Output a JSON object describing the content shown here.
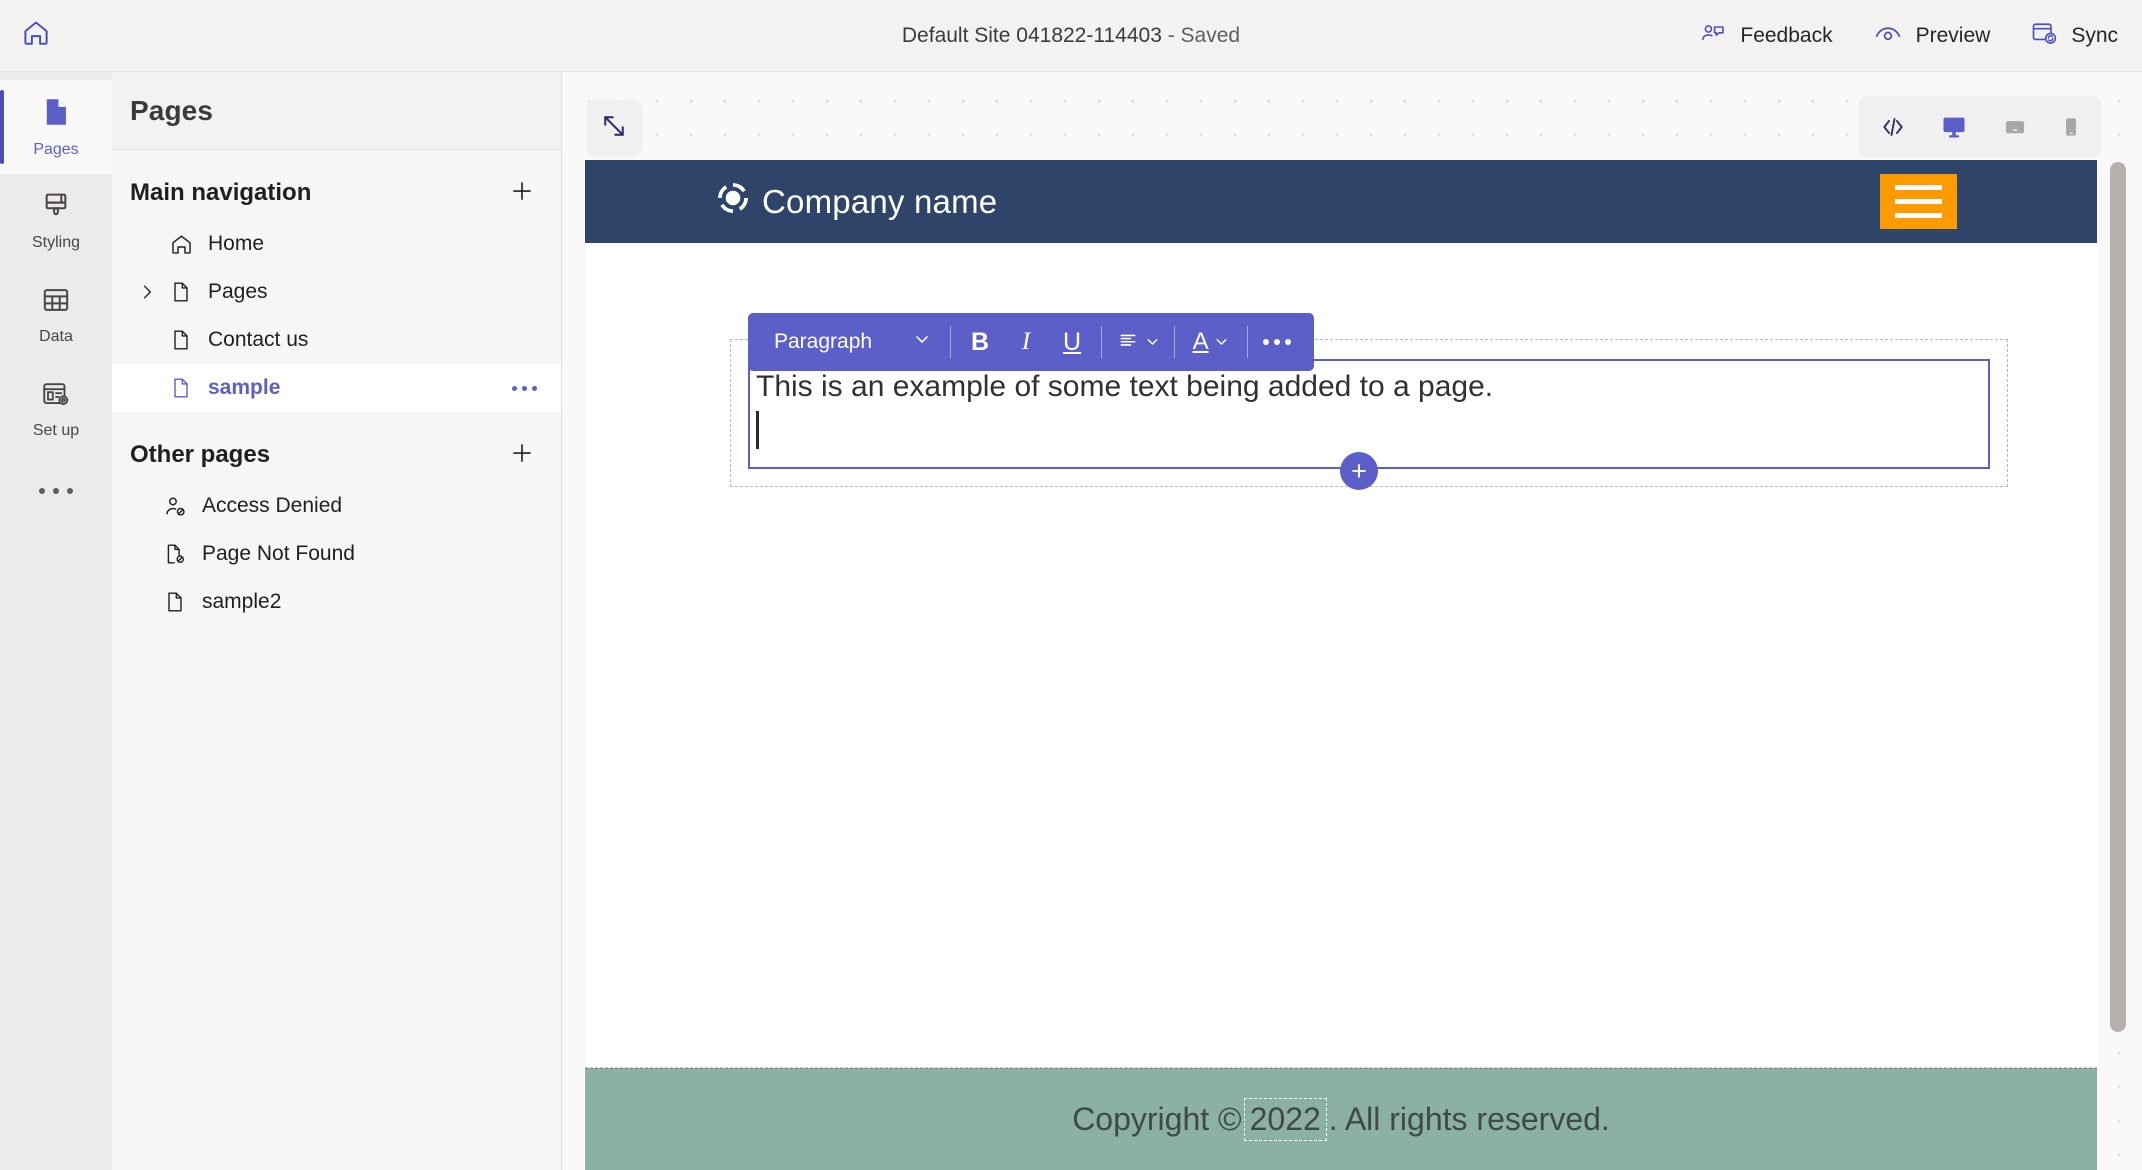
{
  "topbar": {
    "home_icon": "home-icon",
    "title_main": "Default Site 041822-114403",
    "title_sep": " - ",
    "title_state": "Saved",
    "actions": [
      {
        "label": "Feedback",
        "icon": "feedback-person-chat-icon"
      },
      {
        "label": "Preview",
        "icon": "eye-preview-icon"
      },
      {
        "label": "Sync",
        "icon": "sync-browser-icon"
      }
    ]
  },
  "rail": {
    "items": [
      {
        "label": "Pages",
        "icon": "page-document-icon",
        "active": true
      },
      {
        "label": "Styling",
        "icon": "paint-brush-icon",
        "active": false
      },
      {
        "label": "Data",
        "icon": "table-grid-icon",
        "active": false
      },
      {
        "label": "Set up",
        "icon": "setup-gear-window-icon",
        "active": false
      }
    ],
    "overflow_icon": "ellipsis-icon"
  },
  "panel": {
    "title": "Pages",
    "groups": [
      {
        "title": "Main navigation",
        "add_icon": "plus-icon",
        "items": [
          {
            "label": "Home",
            "icon": "home-outline-icon",
            "expandable": false,
            "selected": false
          },
          {
            "label": "Pages",
            "icon": "page-outline-icon",
            "expandable": true,
            "selected": false
          },
          {
            "label": "Contact us",
            "icon": "page-outline-icon",
            "expandable": false,
            "selected": false
          },
          {
            "label": "sample",
            "icon": "page-outline-icon",
            "expandable": false,
            "selected": true,
            "more_icon": "more-ellipsis-icon"
          }
        ]
      },
      {
        "title": "Other pages",
        "add_icon": "plus-icon",
        "items": [
          {
            "label": "Access Denied",
            "icon": "person-denied-icon",
            "expandable": false,
            "selected": false
          },
          {
            "label": "Page Not Found",
            "icon": "page-denied-icon",
            "expandable": false,
            "selected": false
          },
          {
            "label": "sample2",
            "icon": "page-outline-icon",
            "expandable": false,
            "selected": false
          }
        ]
      }
    ]
  },
  "canvas": {
    "expand_icon": "expand-diagonal-icon",
    "devices": [
      {
        "name": "code-view",
        "icon": "code-brackets-icon",
        "active": false
      },
      {
        "name": "desktop-view",
        "icon": "monitor-icon",
        "active": true
      },
      {
        "name": "tablet-view",
        "icon": "tablet-icon",
        "active": false
      },
      {
        "name": "mobile-view",
        "icon": "phone-icon",
        "active": false
      }
    ]
  },
  "site": {
    "header": {
      "logo_icon": "circle-logo-icon",
      "company_name": "Company name",
      "menu_icon": "hamburger-menu-icon"
    },
    "editor": {
      "toolbar": {
        "style_label": "Paragraph",
        "style_chevron": "chevron-down-icon",
        "bold_label": "B",
        "italic_label": "I",
        "underline_label": "U",
        "align_icon": "align-lines-icon",
        "font_color_label": "A",
        "more_icon": "more-ellipsis-icon"
      },
      "content_text": "This is an example of some text being added to a page.",
      "add_section_icon": "plus-circle-icon"
    },
    "footer": {
      "prefix": "Copyright © ",
      "year": "2022",
      "suffix": ". All rights reserved."
    }
  },
  "colors": {
    "accent_purple": "#5b5fc7",
    "site_header_navy": "#2e4468",
    "menu_orange": "#ff9a00",
    "footer_green": "#8bb0a6",
    "rail_bg": "#edebe9",
    "panel_bg": "#f7f6f5"
  }
}
